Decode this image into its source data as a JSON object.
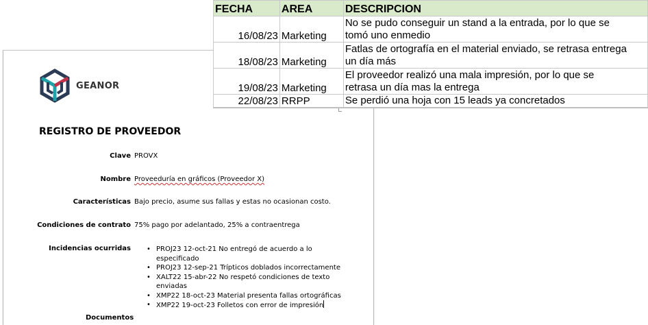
{
  "document": {
    "logo_text": "GEANOR",
    "title": "REGISTRO DE PROVEEDOR",
    "fields": [
      {
        "label": "Clave",
        "value": "PROVX"
      },
      {
        "label": "Nombre",
        "value": "Proveeduría en gráficos (Proveedor X)"
      },
      {
        "label": "Características",
        "value": "Bajo precio, asume sus fallas y estas no ocasionan costo."
      },
      {
        "label": "Condiciones de contrato",
        "value": "75% pago por adelantado, 25% a contraentrega"
      }
    ],
    "incidents_label": "Incidencias ocurridas",
    "incidents": [
      {
        "line1": "PROJ23 12-oct-21 No entregó de acuerdo a lo",
        "line2": "especificado"
      },
      {
        "line1": "PROJ23 12-sep-21 Trípticos doblados incorrectamente",
        "line2": ""
      },
      {
        "line1": "XALT22 15-abr-22 No respetó condiciones de texto",
        "line2": "enviadas"
      },
      {
        "line1": "XMP22 18-oct-23 Material presenta fallas ortográficas",
        "line2": ""
      },
      {
        "line1": "XMP22 19-oct-23 Folletos con error de impresión",
        "line2": ""
      }
    ],
    "next_label": "Documentos"
  },
  "sheet": {
    "headers": [
      "FECHA",
      "AREA",
      "DESCRIPCION"
    ],
    "header_color": "#d9eaca",
    "rows": [
      {
        "date": "16/08/23",
        "area": "Marketing",
        "desc1": "No se pudo conseguir un stand a la entrada, por lo que se",
        "desc2": "tomó uno enmedio"
      },
      {
        "date": "18/08/23",
        "area": "Marketing",
        "desc1": "Fatlas de ortografía en el material enviado, se retrasa entrega",
        "desc2": "un día más"
      },
      {
        "date": "19/08/23",
        "area": "Marketing",
        "desc1": "El proveedor realizó una mala impresión, por lo que se",
        "desc2": "retrasa un día mas la entrega"
      },
      {
        "date": "22/08/23",
        "area": "RRPP",
        "desc1": "Se perdió una hoja con 15 leads ya concretados",
        "desc2": ""
      }
    ]
  }
}
